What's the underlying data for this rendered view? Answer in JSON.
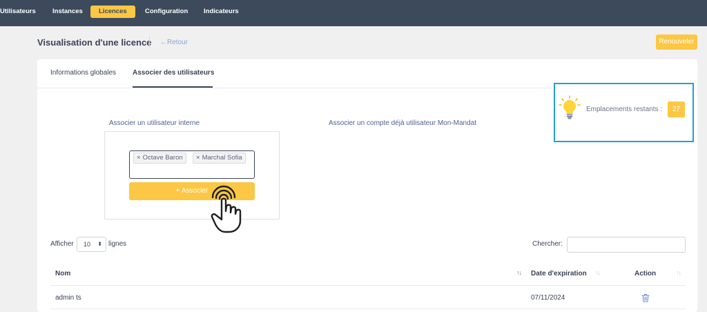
{
  "nav": {
    "items": [
      {
        "label": "Utilisateurs"
      },
      {
        "label": "Instances"
      },
      {
        "label": "Licences",
        "active": true
      },
      {
        "label": "Configuration"
      },
      {
        "label": "Indicateurs"
      }
    ]
  },
  "header": {
    "title": "Visualisation d'une licence",
    "back_label": "←Retour",
    "renew_label": "Renouveler"
  },
  "tabs": [
    {
      "label": "Informations globales"
    },
    {
      "label": "Associer des utilisateurs",
      "active": true
    }
  ],
  "hint": {
    "label": "Emplacements restants :",
    "count": "27",
    "icon": "lightbulb-icon"
  },
  "internal": {
    "label": "Associer un utilisateur interne",
    "tags": [
      "Octave Baron",
      "Marchal Sofia"
    ],
    "button_label": "+ Associer"
  },
  "external": {
    "label": "Associer un compte déjà utilisateur Mon-Mandat"
  },
  "table_controls": {
    "show_label": "Afficher",
    "page_length": "10",
    "rows_label": "lignes",
    "search_label": "Chercher:",
    "search_value": ""
  },
  "table": {
    "columns": [
      "Nom",
      "Date d'expiration",
      "Action"
    ],
    "rows": [
      {
        "name": "admin ts",
        "expiration": "07/11/2024",
        "action_icon": "trash-icon"
      }
    ]
  },
  "colors": {
    "nav_bg": "#3c4a5c",
    "accent": "#fbc744",
    "highlight_border": "#1e9fd6",
    "back_link": "#8da4d6"
  }
}
